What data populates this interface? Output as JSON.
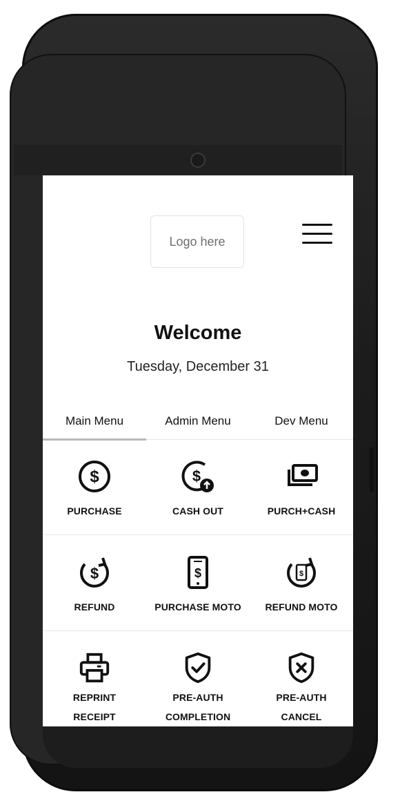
{
  "header": {
    "logo_text": "Logo here",
    "menu_icon": "hamburger-menu-icon"
  },
  "welcome": {
    "title": "Welcome",
    "date": "Tuesday, December 31"
  },
  "tabs": [
    {
      "label": "Main Menu",
      "active": true
    },
    {
      "label": "Admin Menu",
      "active": false
    },
    {
      "label": "Dev Menu",
      "active": false
    }
  ],
  "actions": [
    {
      "label": "PURCHASE",
      "icon": "dollar-circle-icon"
    },
    {
      "label": "CASH OUT",
      "icon": "dollar-cashout-icon"
    },
    {
      "label": "PURCH+CASH",
      "icon": "banknotes-icon"
    },
    {
      "label": "REFUND",
      "icon": "dollar-refund-icon"
    },
    {
      "label": "PURCHASE MOTO",
      "icon": "phone-dollar-icon"
    },
    {
      "label": "REFUND MOTO",
      "icon": "phone-refund-icon"
    },
    {
      "label_line1": "REPRINT",
      "label_line2": "RECEIPT",
      "icon": "printer-icon"
    },
    {
      "label_line1": "PRE-AUTH",
      "label_line2": "COMPLETION",
      "icon": "shield-check-icon"
    },
    {
      "label_line1": "PRE-AUTH",
      "label_line2": "CANCEL",
      "icon": "shield-x-icon"
    }
  ]
}
